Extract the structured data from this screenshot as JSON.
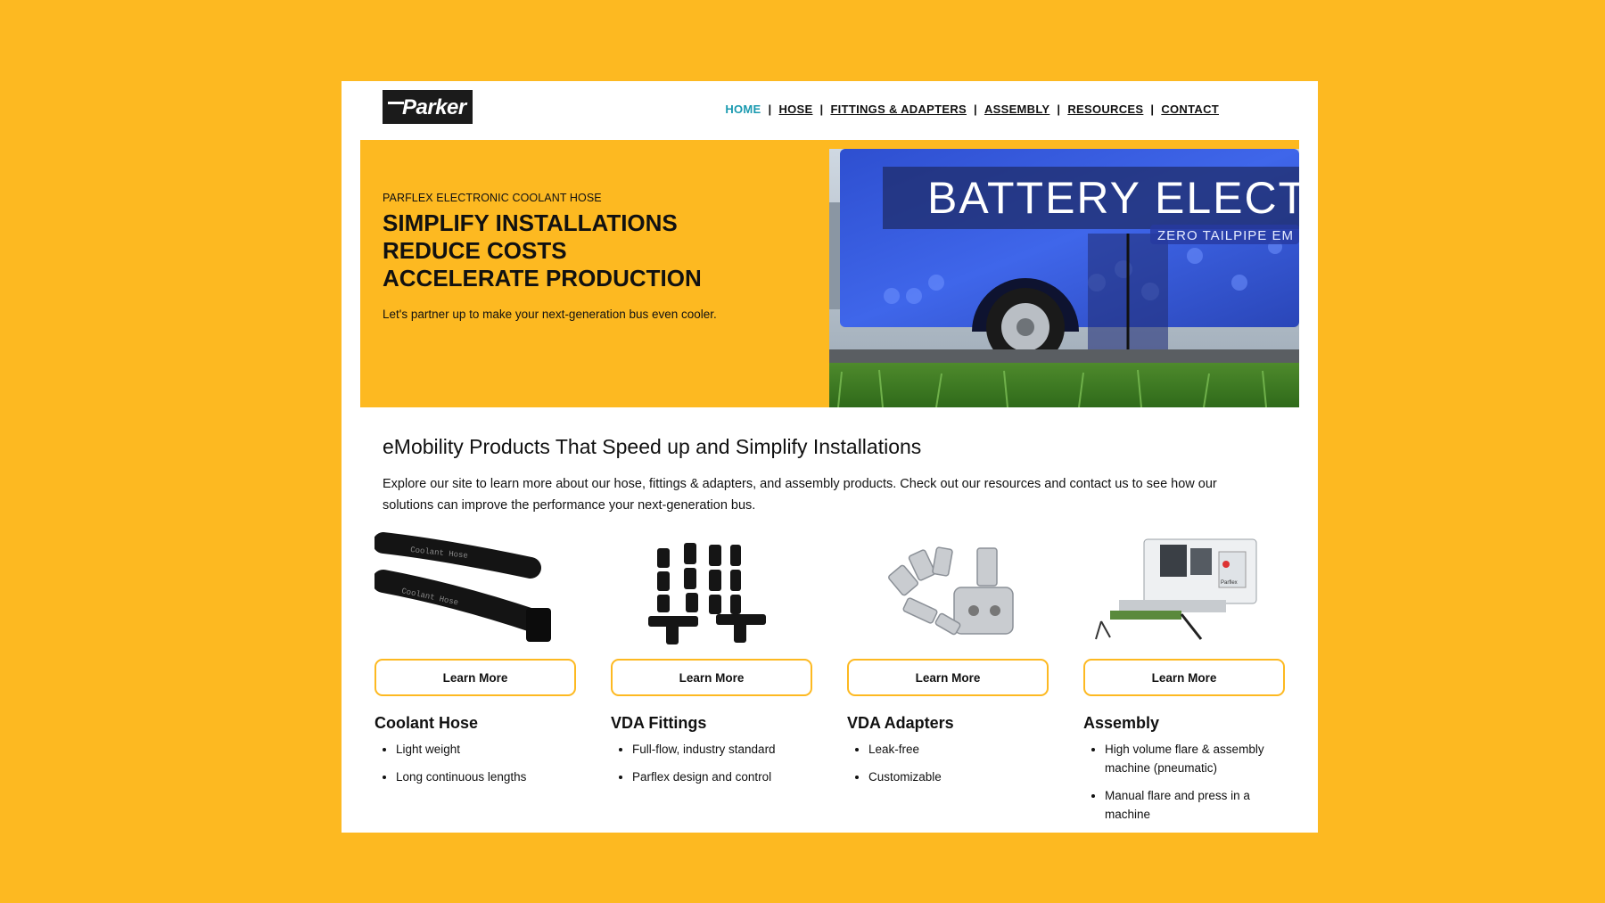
{
  "logo": {
    "alt": "Parker",
    "text": "Parker"
  },
  "nav": {
    "items": [
      {
        "label": "HOME",
        "active": true
      },
      {
        "label": "HOSE"
      },
      {
        "label": "FITTINGS & ADAPTERS"
      },
      {
        "label": "ASSEMBLY"
      },
      {
        "label": "RESOURCES"
      },
      {
        "label": "CONTACT"
      }
    ],
    "separator": "|",
    "active_color": "#1a9ab0"
  },
  "hero": {
    "eyebrow": "PARFLEX ELECTRONIC COOLANT HOSE",
    "headline_lines": [
      "SIMPLIFY INSTALLATIONS",
      "REDUCE COSTS",
      "ACCELERATE PRODUCTION"
    ],
    "subtext": "Let's partner up to make your next-generation bus even cooler.",
    "image": {
      "bus_text": "BATTERY ELECT",
      "bus_subtext": "ZERO TAILPIPE EM"
    },
    "background_color": "#FDB921"
  },
  "intro": {
    "title": "eMobility Products That Speed up and Simplify Installations",
    "body": "Explore our site to learn more about our hose, fittings & adapters, and assembly products. Check out our resources and contact us to see how our solutions can improve the performance your next-generation bus."
  },
  "products": [
    {
      "title": "Coolant Hose",
      "button": "Learn More",
      "bullets": [
        "Light weight",
        "Long continuous lengths"
      ],
      "image_label": "Coolant Hose"
    },
    {
      "title": "VDA Fittings",
      "button": "Learn More",
      "bullets": [
        "Full-flow, industry standard",
        "Parflex design and control"
      ]
    },
    {
      "title": "VDA Adapters",
      "button": "Learn More",
      "bullets": [
        "Leak-free",
        "Customizable"
      ]
    },
    {
      "title": "Assembly",
      "button": "Learn More",
      "bullets": [
        "High volume flare & assembly machine (pneumatic)",
        "Manual flare and press in a machine"
      ],
      "image_label": "Parflex"
    }
  ],
  "colors": {
    "accent": "#FDB921",
    "text": "#111111",
    "page": "#ffffff"
  }
}
